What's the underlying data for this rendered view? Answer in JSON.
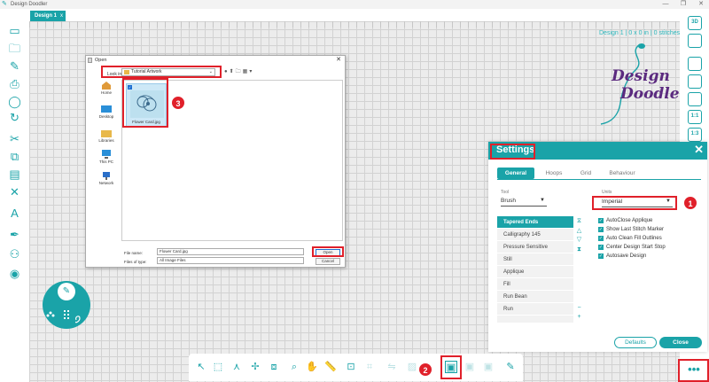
{
  "window": {
    "title": "Design Doodler",
    "controls": [
      "—",
      "❐",
      "✕"
    ]
  },
  "tab": {
    "label": "Design 1",
    "close": "x"
  },
  "canvas": {
    "design_info": "Design 1  |  0 x 0 in  |  0 stitches"
  },
  "logo": {
    "line1": "Design",
    "line2": "Doodler"
  },
  "right_toolbar": {
    "items": [
      {
        "name": "3d-view",
        "label": "3D"
      },
      {
        "name": "frame",
        "label": ""
      },
      {
        "name": "grid",
        "label": ""
      },
      {
        "name": "hoop",
        "label": ""
      },
      {
        "name": "stitch",
        "label": ""
      },
      {
        "name": "zoom-1-1",
        "label": "1:1"
      },
      {
        "name": "fit",
        "label": "1:3"
      }
    ]
  },
  "open_dialog": {
    "title": "Open",
    "close": "✕",
    "look_in_label": "Look in:",
    "look_in_value": "Tutorial Artwork",
    "places": [
      "Home",
      "Desktop",
      "Libraries",
      "This PC",
      "Network"
    ],
    "file": {
      "name": "Flower Card.jpg"
    },
    "file_name_label": "File name:",
    "file_name_value": "Flower Card.jpg",
    "files_of_type_label": "Files of type:",
    "files_of_type_value": "All Image Files",
    "open_label": "Open",
    "cancel_label": "Cancel"
  },
  "markers": [
    "1",
    "2",
    "3"
  ],
  "settings": {
    "title": "Settings",
    "close": "✕",
    "tabs": [
      "General",
      "Hoops",
      "Grid",
      "Behaviour"
    ],
    "active_tab": "General",
    "tool_label": "Tool",
    "tool_value": "Brush",
    "units_label": "Units",
    "units_value": "Imperial",
    "brushes": [
      "Tapered Ends",
      "Calligraphy 145",
      "Pressure Sensitive",
      "Still",
      "Applique",
      "Fill",
      "Run Bean",
      "Run"
    ],
    "selected_brush": "Tapered Ends",
    "options": [
      "AutoClose Applique",
      "Show Last Stitch Marker",
      "Auto Clean Fill Outlines",
      "Center Design Start Stop",
      "Autosave Design"
    ],
    "defaults_label": "Defaults",
    "close_label": "Close"
  },
  "colors": {
    "accent": "#1aa3a8",
    "highlight": "#e0202a",
    "logo": "#5b2a7f"
  },
  "more_button": "•••"
}
